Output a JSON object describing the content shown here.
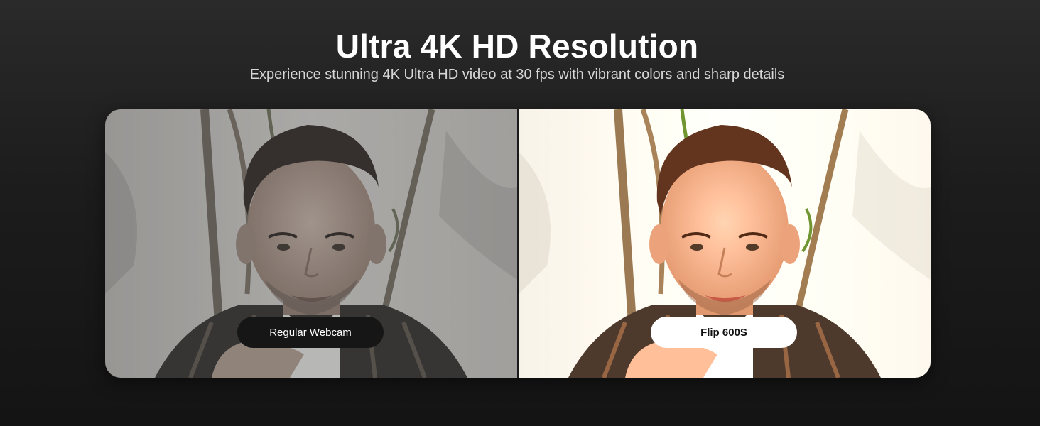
{
  "header": {
    "title": "Ultra 4K HD Resolution",
    "subtitle": "Experience stunning 4K Ultra HD video at 30 fps with vibrant colors and sharp details"
  },
  "comparison": {
    "left": {
      "label": "Regular Webcam"
    },
    "right": {
      "label": "Flip 600S"
    }
  }
}
